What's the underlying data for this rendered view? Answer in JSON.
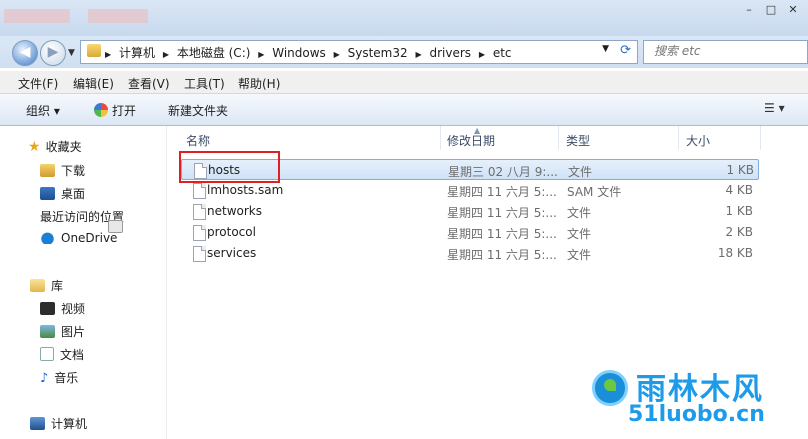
{
  "address": {
    "crumbs": [
      "计算机",
      "本地磁盘 (C:)",
      "Windows",
      "System32",
      "drivers",
      "etc"
    ],
    "search_placeholder": "搜索 etc"
  },
  "menu": [
    "文件(F)",
    "编辑(E)",
    "查看(V)",
    "工具(T)",
    "帮助(H)"
  ],
  "toolbar": {
    "organize": "组织 ▾",
    "open": "打开",
    "new_folder": "新建文件夹",
    "view_icon": "☰ ▾"
  },
  "nav": {
    "favorites": "收藏夹",
    "downloads": "下载",
    "desktop": "桌面",
    "recent": "最近访问的位置",
    "onedrive": "OneDrive",
    "libraries": "库",
    "videos": "视频",
    "pictures": "图片",
    "documents": "文档",
    "music": "音乐",
    "computer": "计算机"
  },
  "columns": {
    "name": "名称",
    "date": "修改日期",
    "type": "类型",
    "size": "大小"
  },
  "files": [
    {
      "name": "hosts",
      "date": "星期三 02 八月 9:...",
      "type": "文件",
      "size": "1 KB"
    },
    {
      "name": "lmhosts.sam",
      "date": "星期四 11 六月 5:...",
      "type": "SAM 文件",
      "size": "4 KB"
    },
    {
      "name": "networks",
      "date": "星期四 11 六月 5:...",
      "type": "文件",
      "size": "1 KB"
    },
    {
      "name": "protocol",
      "date": "星期四 11 六月 5:...",
      "type": "文件",
      "size": "2 KB"
    },
    {
      "name": "services",
      "date": "星期四 11 六月 5:...",
      "type": "文件",
      "size": "18 KB"
    }
  ],
  "watermark": {
    "big": "雨林木风",
    "small": "51luobo.cn"
  }
}
